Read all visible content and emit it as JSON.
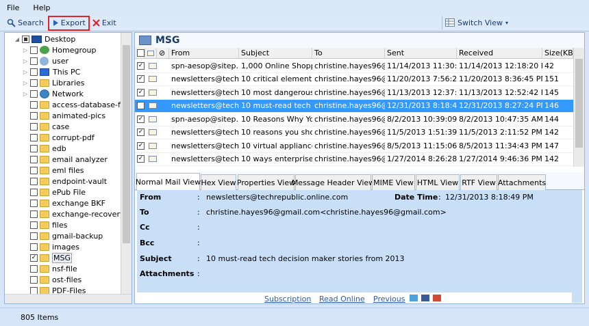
{
  "menu": {
    "file": "File",
    "help": "Help"
  },
  "toolbar": {
    "search": "Search",
    "export": "Export",
    "exit": "Exit",
    "switch_view": "Switch View"
  },
  "tree": {
    "items": [
      {
        "label": "Desktop"
      },
      {
        "label": "Homegroup"
      },
      {
        "label": "user"
      },
      {
        "label": "This PC"
      },
      {
        "label": "Libraries"
      },
      {
        "label": "Network"
      },
      {
        "label": "access-database-file"
      },
      {
        "label": "animated-pics"
      },
      {
        "label": "case"
      },
      {
        "label": "corrupt-pdf"
      },
      {
        "label": "edb"
      },
      {
        "label": "email analyzer"
      },
      {
        "label": "eml files"
      },
      {
        "label": "endpoint-vault"
      },
      {
        "label": "ePub File"
      },
      {
        "label": "exchange BKF"
      },
      {
        "label": "exchange-recovery"
      },
      {
        "label": "files"
      },
      {
        "label": "gmail-backup"
      },
      {
        "label": "images"
      },
      {
        "label": "MSG"
      },
      {
        "label": "nsf-file"
      },
      {
        "label": "ost-files"
      },
      {
        "label": "PDF-Files"
      }
    ]
  },
  "folder_title": "MSG",
  "grid": {
    "columns": {
      "from": "From",
      "subject": "Subject",
      "to": "To",
      "sent": "Sent",
      "received": "Received",
      "size": "Size(KB)"
    },
    "rows": [
      {
        "from": "spn-aesop@sitep...",
        "subject": "1,000 Online Shopp...",
        "to": "christine.hayes96@...",
        "sent": "11/14/2013 11:30:00...",
        "received": "11/14/2013 12:18:20 PM",
        "size": "42"
      },
      {
        "from": "newsletters@tech...",
        "subject": "10 critical elements ...",
        "to": "christine.hayes96@...",
        "sent": "11/20/2013 7:56:21 PM",
        "received": "11/20/2013 8:36:45 PM",
        "size": "151"
      },
      {
        "from": "newsletters@tech...",
        "subject": "10 most dangerous ...",
        "to": "christine.hayes96@...",
        "sent": "11/13/2013 12:37:20...",
        "received": "11/13/2013 12:52:42 PM",
        "size": "145"
      },
      {
        "from": "newsletters@tech...",
        "subject": "10 must-read tech d...",
        "to": "christine.hayes96@...",
        "sent": "12/31/2013 8:18:49 PM",
        "received": "12/31/2013 8:27:24 PM",
        "size": "146"
      },
      {
        "from": "spn-aesop@sitep...",
        "subject": "10 Reasons Why Yo...",
        "to": "christine.hayes96@...",
        "sent": "8/2/2013 10:39:09 AM",
        "received": "8/2/2013 10:47:35 AM",
        "size": "144"
      },
      {
        "from": "newsletters@tech...",
        "subject": "10 reasons you sho...",
        "to": "christine.hayes96@...",
        "sent": "11/5/2013 1:51:39 PM",
        "received": "11/5/2013 2:11:52 PM",
        "size": "142"
      },
      {
        "from": "newsletters@tech...",
        "subject": "10 virtual appliances...",
        "to": "christine.hayes96@...",
        "sent": "8/5/2013 11:15:06 PM",
        "received": "8/5/2013 11:34:43 PM",
        "size": "147"
      },
      {
        "from": "newsletters@tech...",
        "subject": "10 ways enterprise i...",
        "to": "christine.hayes96@...",
        "sent": "1/27/2014 8:26:28 PM",
        "received": "1/27/2014 9:46:36 PM",
        "size": "142"
      }
    ]
  },
  "tabs": [
    "Normal Mail View",
    "Hex View",
    "Properties View",
    "Message Header View",
    "MIME View",
    "HTML View",
    "RTF View",
    "Attachments"
  ],
  "detail": {
    "from_label": "From",
    "from_value": "newsletters@techrepublic.online.com",
    "date_label": "Date Time",
    "date_value": "12/31/2013 8:18:49 PM",
    "to_label": "To",
    "to_value": "christine.hayes96@gmail.com<christine.hayes96@gmail.com>",
    "cc_label": "Cc",
    "cc_value": "",
    "bcc_label": "Bcc",
    "bcc_value": "",
    "subject_label": "Subject",
    "subject_value": "10 must-read tech decision maker stories from 2013",
    "attachments_label": "Attachments",
    "attachments_value": "",
    "colon": ":"
  },
  "preview": {
    "subscription": "Subscription",
    "read_online": "Read Online",
    "previous": "Previous"
  },
  "status": {
    "items": "805 Items"
  }
}
